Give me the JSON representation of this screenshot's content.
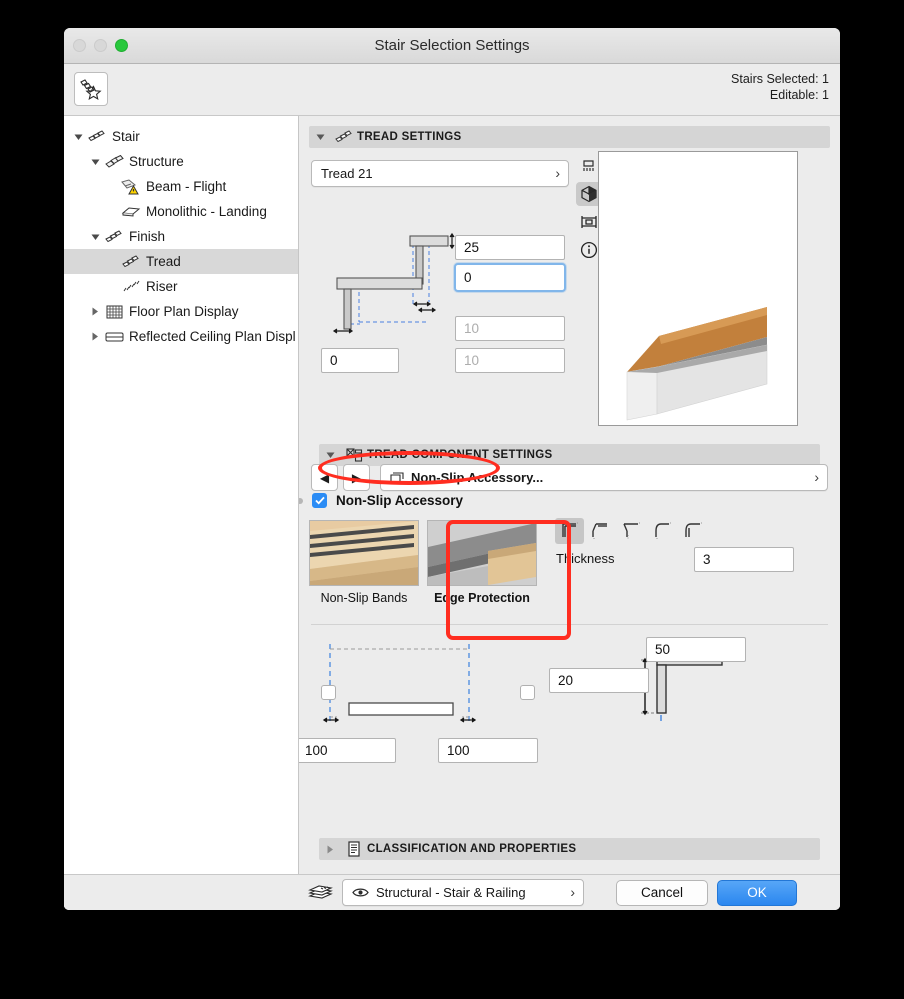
{
  "window": {
    "title": "Stair Selection Settings",
    "traffic_lights": [
      "close-disabled",
      "minimize-disabled",
      "zoom-green"
    ]
  },
  "topbar": {
    "favorites_icon": "stair-favorite-icon",
    "stairs_selected": "Stairs Selected: 1",
    "editable": "Editable: 1"
  },
  "tree": {
    "items": [
      {
        "label": "Stair",
        "icon": "stair-icon",
        "depth": 0,
        "twisty": "down",
        "selected": false
      },
      {
        "label": "Structure",
        "icon": "structure-icon",
        "depth": 1,
        "twisty": "down",
        "selected": false
      },
      {
        "label": "Beam - Flight",
        "icon": "beam-warning-icon",
        "depth": 2,
        "twisty": "none",
        "selected": false
      },
      {
        "label": "Monolithic - Landing",
        "icon": "monolithic-icon",
        "depth": 2,
        "twisty": "none",
        "selected": false
      },
      {
        "label": "Finish",
        "icon": "finish-icon",
        "depth": 1,
        "twisty": "down",
        "selected": false
      },
      {
        "label": "Tread",
        "icon": "tread-icon",
        "depth": 2,
        "twisty": "none",
        "selected": true
      },
      {
        "label": "Riser",
        "icon": "riser-icon",
        "depth": 2,
        "twisty": "none",
        "selected": false
      },
      {
        "label": "Floor Plan Display",
        "icon": "floorplan-icon",
        "depth": 1,
        "twisty": "right",
        "selected": false
      },
      {
        "label": "Reflected Ceiling Plan Displ",
        "icon": "rcp-icon",
        "depth": 1,
        "twisty": "right",
        "selected": false
      }
    ]
  },
  "tread_settings": {
    "header": "TREAD SETTINGS",
    "header_icon": "tread-icon",
    "expanded": true,
    "selector_value": "Tread 21",
    "fields": {
      "top_thickness": "25",
      "offset": "0",
      "left_bottom": "0",
      "mid_disabled_1": "10",
      "mid_disabled_2": "10"
    },
    "view_modes": [
      {
        "name": "plan-view-icon",
        "active": false
      },
      {
        "name": "3d-view-icon",
        "active": true
      },
      {
        "name": "section-view-icon",
        "active": false
      },
      {
        "name": "info-icon",
        "active": false
      }
    ]
  },
  "tread_component_settings": {
    "header": "TREAD COMPONENT SETTINGS",
    "header_icon": "component-icon",
    "expanded": true,
    "prev_label": "◀",
    "next_label": "▶",
    "component_value": "Non-Slip Accessory...",
    "accessory_checkbox": {
      "label": "Non-Slip Accessory",
      "checked": true
    },
    "thumbnails": [
      {
        "label": "Non-Slip Bands",
        "selected": false
      },
      {
        "label": "Edge Protection",
        "selected": true
      }
    ],
    "profiles": [
      {
        "name": "square-corner-profile-icon",
        "active": true
      },
      {
        "name": "chamfer-corner-profile-icon",
        "active": false
      },
      {
        "name": "angled-corner-profile-icon",
        "active": false
      },
      {
        "name": "round-corner-profile-icon",
        "active": false
      },
      {
        "name": "bullnose-corner-profile-icon",
        "active": false
      }
    ],
    "thickness_label": "Thickness",
    "thickness_value": "3",
    "dimensions": {
      "left_width": "100",
      "right_width": "100",
      "height": "20",
      "leg_length": "50"
    },
    "checkboxes": [
      {
        "name": "left-align-checkbox",
        "checked": false
      },
      {
        "name": "right-align-checkbox",
        "checked": false
      }
    ]
  },
  "classification": {
    "header": "CLASSIFICATION AND PROPERTIES",
    "header_icon": "properties-icon",
    "expanded": false
  },
  "footer": {
    "layers_icon": "layers-stack-icon",
    "eye_icon": "eye-icon",
    "layer_value": "Structural - Stair & Railing",
    "cancel_label": "Cancel",
    "ok_label": "OK"
  },
  "annotations": {
    "accent_color": "#ff2d20",
    "highlight_accessory_checkbox": true,
    "highlight_edge_protection": true
  }
}
